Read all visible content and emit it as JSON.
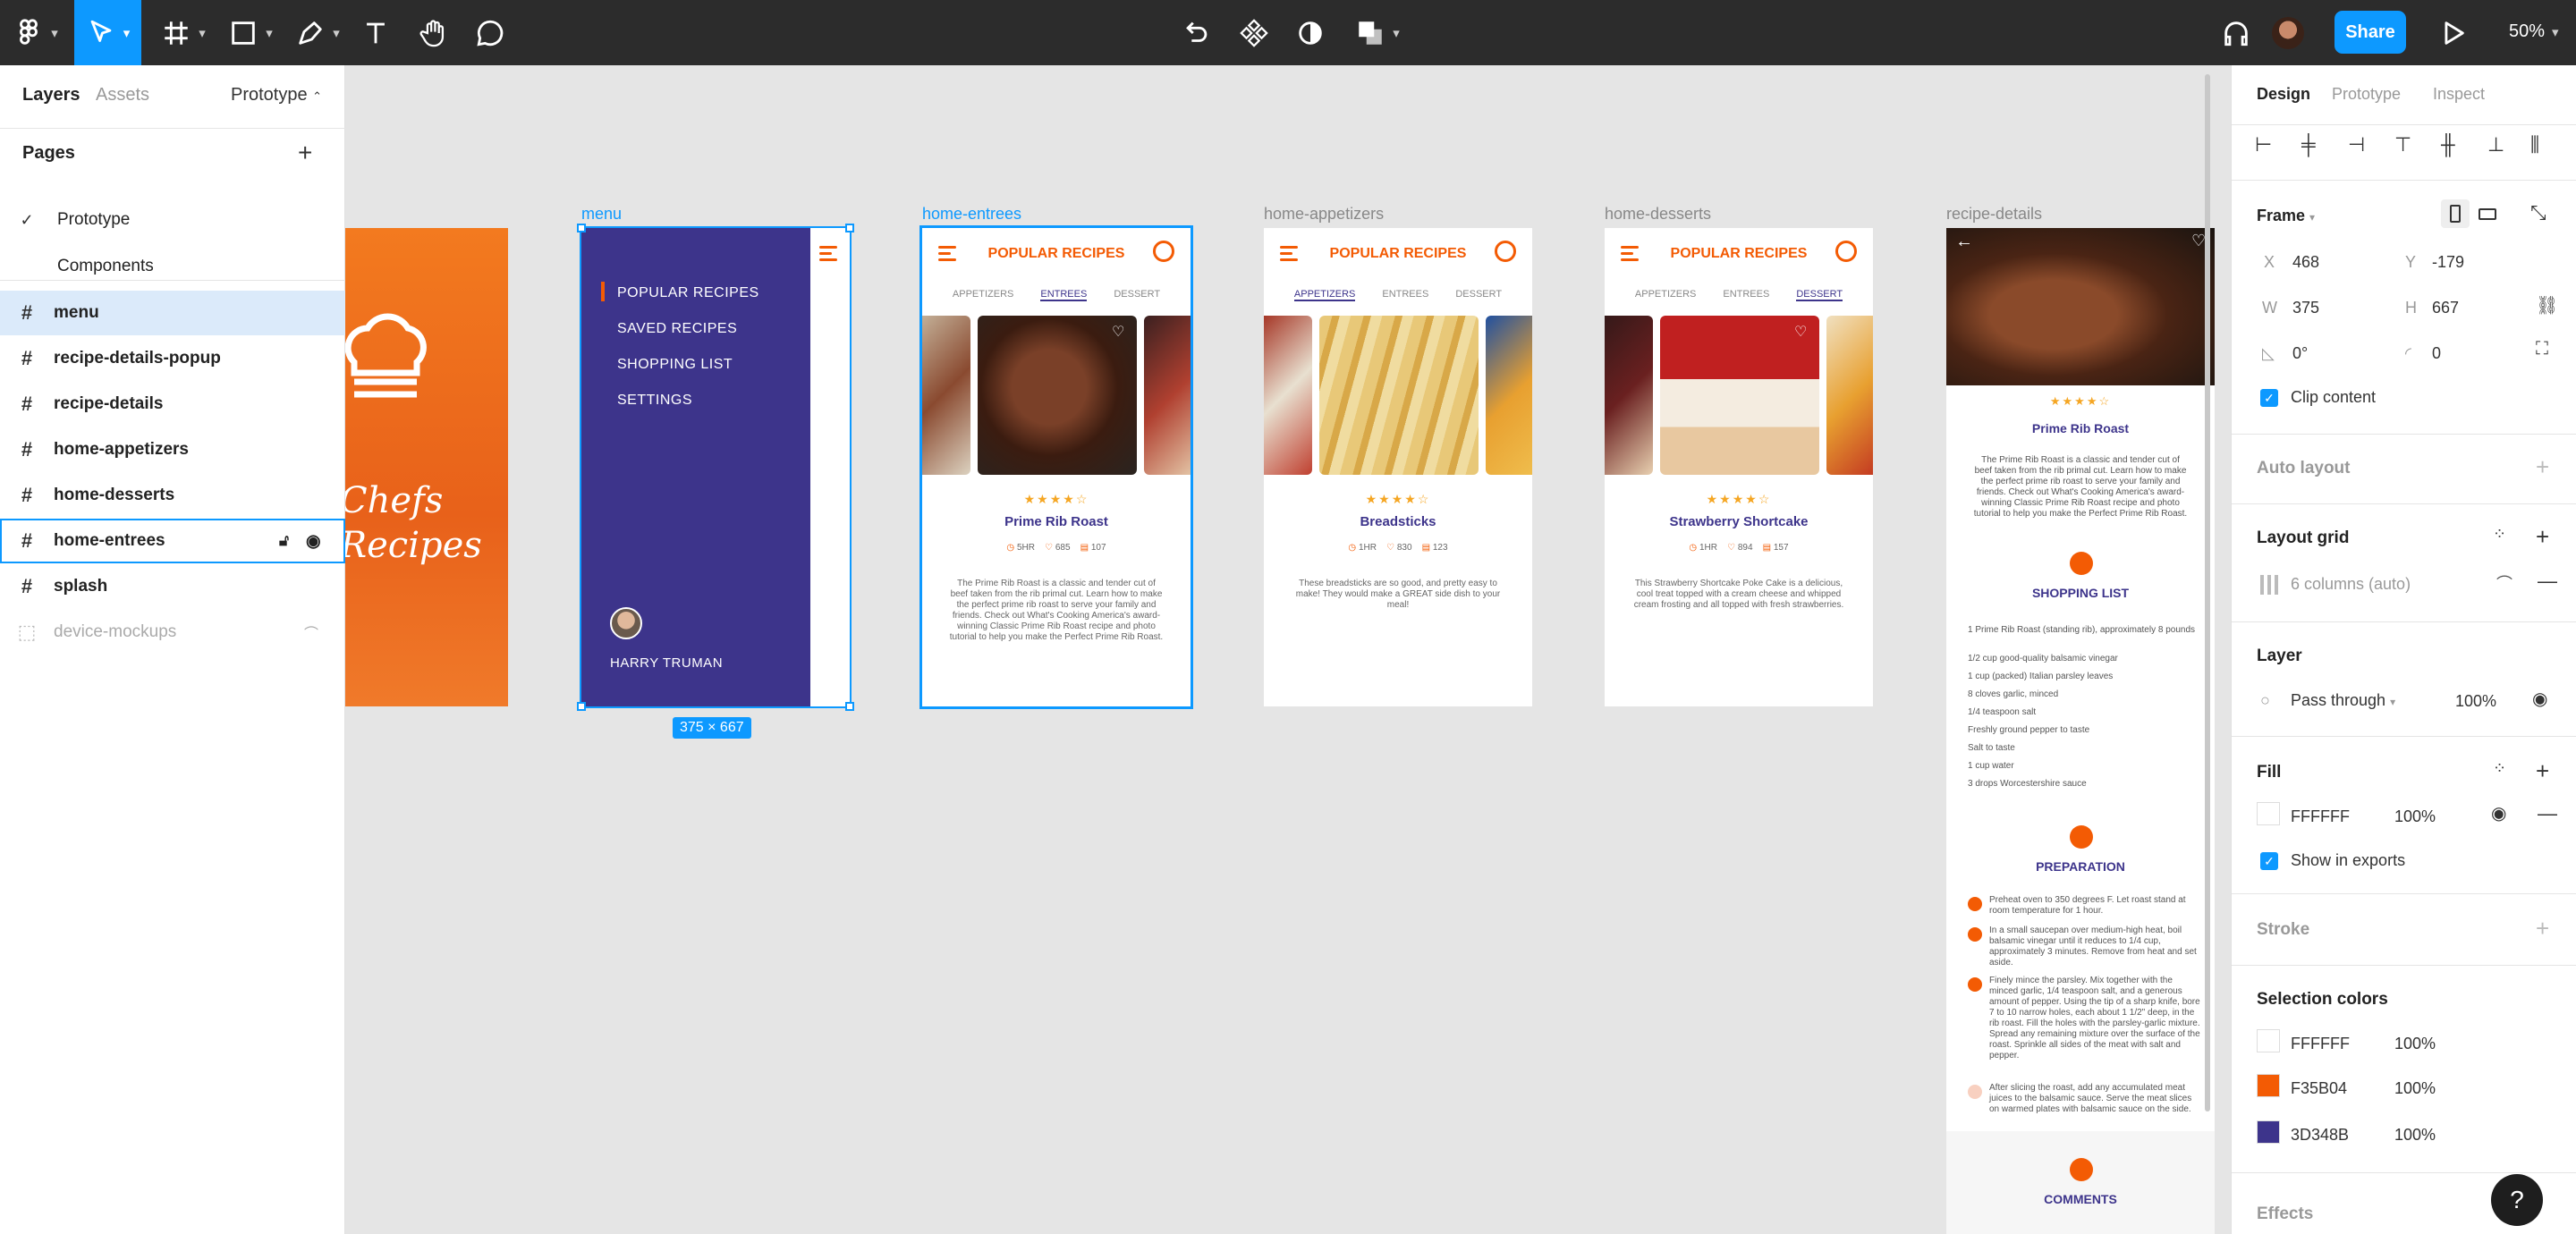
{
  "toolbar": {
    "zoom": "50%",
    "share": "Share"
  },
  "left": {
    "tabs": [
      "Layers",
      "Assets"
    ],
    "mode": "Prototype",
    "pages_title": "Pages",
    "pages": [
      "Prototype",
      "Components"
    ],
    "layers": [
      "menu",
      "recipe-details-popup",
      "recipe-details",
      "home-appetizers",
      "home-desserts",
      "home-entrees",
      "splash",
      "device-mockups"
    ]
  },
  "canvas": {
    "frame_labels": [
      "menu",
      "home-entrees",
      "home-appetizers",
      "home-desserts",
      "recipe-details"
    ],
    "size_badge": "375 × 667",
    "splash_text": [
      "Chefs",
      "Recipes"
    ],
    "menu": {
      "items": [
        "POPULAR RECIPES",
        "SAVED RECIPES",
        "SHOPPING LIST",
        "SETTINGS"
      ],
      "user": "HARRY TRUMAN"
    },
    "app_title": "POPULAR RECIPES",
    "tab_names": [
      "APPETIZERS",
      "ENTREES",
      "DESSERT"
    ],
    "entrees": {
      "name": "Prime Rib Roast",
      "time": "5HR",
      "likes": "685",
      "comments": "107",
      "desc": "The Prime Rib Roast is a classic and tender cut of beef taken from the rib primal cut. Learn how to make the perfect prime rib roast to serve your family and friends. Check out What's Cooking America's award-winning Classic Prime Rib Roast recipe and photo tutorial to help you make the Perfect Prime Rib Roast."
    },
    "appetizers": {
      "name": "Breadsticks",
      "time": "1HR",
      "likes": "830",
      "comments": "123",
      "desc": "These breadsticks are so good, and pretty easy to make! They would make a GREAT side dish to your meal!"
    },
    "desserts": {
      "name": "Strawberry Shortcake",
      "time": "1HR",
      "likes": "894",
      "comments": "157",
      "desc": "This Strawberry Shortcake Poke Cake is a delicious, cool treat topped with a cream cheese and whipped cream frosting and all topped with fresh strawberries."
    },
    "details": {
      "name": "Prime Rib Roast",
      "desc": "The Prime Rib Roast is a classic and tender cut of beef taken from the rib primal cut. Learn how to make the perfect prime rib roast to serve your family and friends. Check out What's Cooking America's award-winning Classic Prime Rib Roast recipe and photo tutorial to help you make the Perfect Prime Rib Roast.",
      "shopping_title": "SHOPPING LIST",
      "ingredients": [
        "1 Prime Rib Roast (standing rib), approximately 8 pounds",
        "1/2 cup good-quality balsamic vinegar",
        "1 cup (packed) Italian parsley leaves",
        "8 cloves garlic, minced",
        "1/4 teaspoon salt",
        "Freshly ground pepper to taste",
        "Salt to taste",
        "1 cup water",
        "3 drops Worcestershire sauce"
      ],
      "prep_title": "PREPARATION",
      "steps": [
        "Preheat oven to 350 degrees F. Let roast stand at room temperature for 1 hour.",
        "In a small saucepan over medium-high heat, boil balsamic vinegar until it reduces to 1/4 cup, approximately 3 minutes. Remove from heat and set aside.",
        "Finely mince the parsley. Mix together with the minced garlic, 1/4 teaspoon salt, and a generous amount of pepper. Using the tip of a sharp knife, bore 7 to 10 narrow holes, each about 1 1/2\" deep, in the rib roast. Fill the holes with the parsley-garlic mixture. Spread any remaining mixture over the surface of the roast. Sprinkle all sides of the meat with salt and pepper.",
        "After slicing the roast, add any accumulated meat juices to the balsamic sauce. Serve the meat slices on warmed plates with balsamic sauce on the side."
      ],
      "comments_title": "COMMENTS"
    }
  },
  "right": {
    "tabs": [
      "Design",
      "Prototype",
      "Inspect"
    ],
    "frame_label": "Frame",
    "x_label": "X",
    "x": "468",
    "y_label": "Y",
    "y": "-179",
    "w_label": "W",
    "w": "375",
    "h_label": "H",
    "h": "667",
    "rotation": "0°",
    "radius": "0",
    "clip": "Clip content",
    "auto_layout": "Auto layout",
    "layout_grid": "Layout grid",
    "grid_value": "6 columns (auto)",
    "layer": "Layer",
    "blend": "Pass through",
    "layer_opacity": "100%",
    "fill": "Fill",
    "fill_hex": "FFFFFF",
    "fill_opacity": "100%",
    "show_exports": "Show in exports",
    "stroke": "Stroke",
    "selection_colors": "Selection colors",
    "colors": [
      {
        "hex": "FFFFFF",
        "pct": "100%",
        "color": "#FFFFFF"
      },
      {
        "hex": "F35B04",
        "pct": "100%",
        "color": "#F35B04"
      },
      {
        "hex": "3D348B",
        "pct": "100%",
        "color": "#3D348B"
      }
    ],
    "effects": "Effects"
  },
  "colors": {
    "accent": "#0d99ff",
    "orange": "#f35b04",
    "purple": "#3d348b"
  }
}
